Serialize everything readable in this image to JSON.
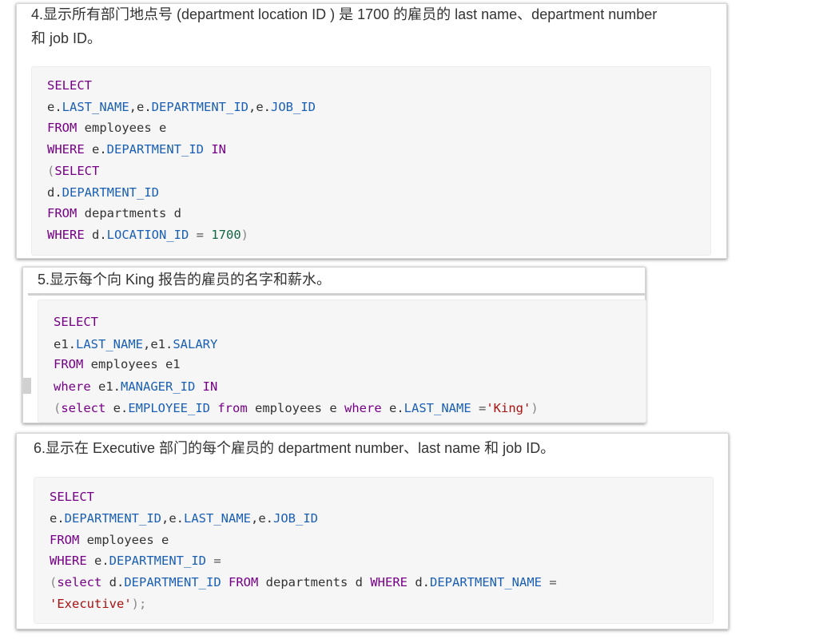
{
  "sections": [
    {
      "question_line1": "4.显示所有部门地点号 (department location ID ) 是 1700 的雇员的 last name、department number",
      "question_line2": "和 job ID。",
      "code": {
        "l1_kw": "SELECT",
        "l2": [
          "e.",
          "LAST_NAME",
          ",e.",
          "DEPARTMENT_ID",
          ",e.",
          "JOB_ID"
        ],
        "l3": [
          "FROM",
          " employees e"
        ],
        "l4": [
          "WHERE",
          " e.",
          "DEPARTMENT_ID",
          " ",
          "IN"
        ],
        "l5": [
          "(",
          "SELECT"
        ],
        "l6": [
          "d.",
          "DEPARTMENT_ID"
        ],
        "l7": [
          "FROM",
          " departments d"
        ],
        "l8": [
          "WHERE",
          " d.",
          "LOCATION_ID",
          " = ",
          "1700",
          ")"
        ]
      }
    },
    {
      "question": "5.显示每个向 King 报告的雇员的名字和薪水。",
      "code": {
        "l1_kw": "SELECT",
        "l2": [
          "e1.",
          "LAST_NAME",
          ",e1.",
          "SALARY"
        ],
        "l3": [
          "FROM",
          " employees e1"
        ],
        "l4": [
          "where",
          " e1.",
          "MANAGER_ID",
          " ",
          "IN"
        ],
        "l5": [
          "(",
          "select",
          " e.",
          "EMPLOYEE_ID",
          " ",
          "from",
          " employees e ",
          "where",
          " e.",
          "LAST_NAME",
          " =",
          "'King'",
          ")"
        ]
      }
    },
    {
      "question": "6.显示在 Executive 部门的每个雇员的 department number、last name 和 job ID。",
      "code": {
        "l1_kw": "SELECT",
        "l2": [
          "e.",
          "DEPARTMENT_ID",
          ",e.",
          "LAST_NAME",
          ",e.",
          "JOB_ID"
        ],
        "l3": [
          "FROM",
          " employees e"
        ],
        "l4": [
          "WHERE",
          " e.",
          "DEPARTMENT_ID",
          " ="
        ],
        "l5": [
          "(",
          "select",
          " d.",
          "DEPARTMENT_ID",
          " ",
          "FROM",
          " departments d ",
          "WHERE",
          " d.",
          "DEPARTMENT_NAME",
          " ="
        ],
        "l6": [
          "'Executive'",
          ");"
        ]
      }
    }
  ]
}
